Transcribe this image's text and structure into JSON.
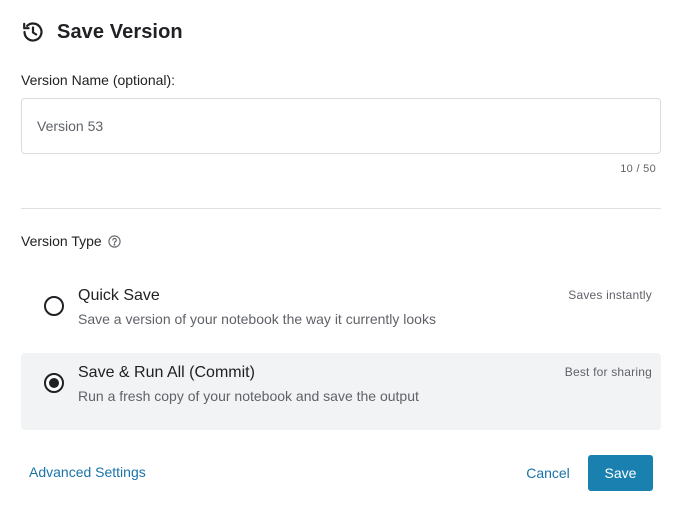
{
  "header": {
    "title": "Save Version",
    "icon": "history-icon"
  },
  "version_name": {
    "label": "Version Name (optional):",
    "value": "Version 53",
    "char_count": "10 / 50"
  },
  "version_type": {
    "label": "Version Type",
    "help_icon": "help-circle-icon",
    "selected": "commit",
    "options": [
      {
        "id": "quick",
        "title": "Quick Save",
        "description": "Save a version of your notebook the way it currently looks",
        "tag": "Saves instantly",
        "checked": false
      },
      {
        "id": "commit",
        "title": "Save & Run All (Commit)",
        "description": "Run a fresh copy of your notebook and save the output",
        "tag": "Best for sharing",
        "checked": true
      }
    ]
  },
  "footer": {
    "advanced_label": "Advanced Settings",
    "cancel_label": "Cancel",
    "save_label": "Save"
  },
  "colors": {
    "accent": "#1a80b0",
    "link": "#1a73a8",
    "selected_bg": "#f1f3f4"
  }
}
